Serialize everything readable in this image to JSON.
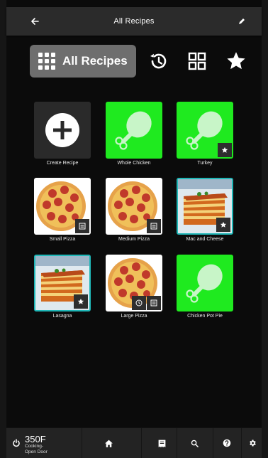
{
  "header": {
    "title": "All Recipes",
    "back_icon": "arrow-left-icon",
    "edit_icon": "pencil-icon"
  },
  "view_selector": {
    "active_label": "All Recipes",
    "icons": [
      "grid-icon",
      "history-icon",
      "tiles-icon",
      "star-icon"
    ]
  },
  "recipes": [
    {
      "name": "Create Recipe",
      "image": "plus-icon",
      "badges": []
    },
    {
      "name": "Whole Chicken",
      "image": "drumstick-icon",
      "badges": []
    },
    {
      "name": "Turkey",
      "image": "drumstick-icon",
      "badges": [
        "star-icon"
      ]
    },
    {
      "name": "Small Pizza",
      "image": "pizza-photo",
      "badges": [
        "list-icon"
      ]
    },
    {
      "name": "Medium Pizza",
      "image": "pizza-photo",
      "badges": [
        "list-icon"
      ]
    },
    {
      "name": "Mac and Cheese",
      "image": "lasagna-photo",
      "badges": [
        "star-icon"
      ]
    },
    {
      "name": "Lasagna",
      "image": "lasagna-photo",
      "badges": [
        "star-icon"
      ]
    },
    {
      "name": "Large Pizza",
      "image": "pizza-photo",
      "badges": [
        "clock-icon",
        "list-icon"
      ]
    },
    {
      "name": "Chicken Pot Pie",
      "image": "drumstick-icon",
      "badges": []
    }
  ],
  "bottom_bar": {
    "temperature": "350F",
    "status": "Cooking-Open Door",
    "icons": [
      "power-icon",
      "home-icon",
      "recipe-book-icon",
      "search-icon",
      "help-icon",
      "settings-icon"
    ]
  },
  "colors": {
    "green_tile": "#1fea1f",
    "drumstick": "#c8f5c8",
    "active_view_bg": "#6e6e6e",
    "photo_border": "#1fb7b7"
  }
}
